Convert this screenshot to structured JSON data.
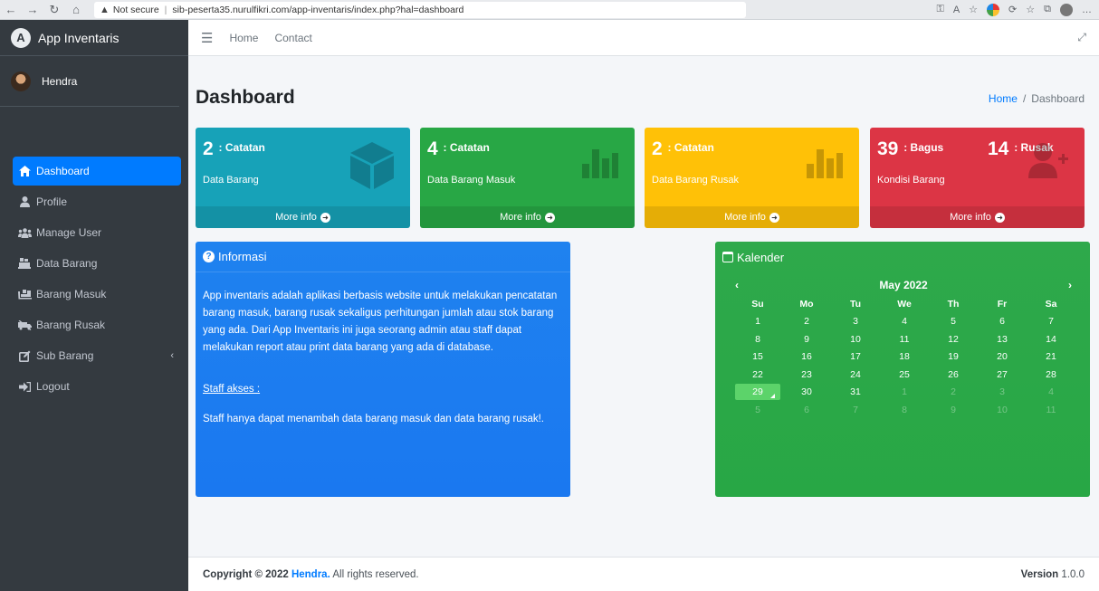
{
  "browser": {
    "security": "Not secure",
    "url": "sib-peserta35.nurulfikri.com/app-inventaris/index.php?hal=dashboard"
  },
  "sidebar": {
    "brand": "App Inventaris",
    "user": "Hendra",
    "items": [
      {
        "label": "Dashboard",
        "icon": "home-icon"
      },
      {
        "label": "Profile",
        "icon": "user-icon"
      },
      {
        "label": "Manage User",
        "icon": "users-icon"
      },
      {
        "label": "Data Barang",
        "icon": "dolly-icon"
      },
      {
        "label": "Barang Masuk",
        "icon": "truck-loading-icon"
      },
      {
        "label": "Barang Rusak",
        "icon": "truck-broken-icon"
      },
      {
        "label": "Sub Barang",
        "icon": "edit-icon"
      },
      {
        "label": "Logout",
        "icon": "sign-out-icon"
      }
    ]
  },
  "topnav": {
    "home": "Home",
    "contact": "Contact"
  },
  "page": {
    "title": "Dashboard",
    "breadcrumb_home": "Home",
    "breadcrumb_current": "Dashboard"
  },
  "boxes": {
    "b1": {
      "value": "2",
      "caption": ": Catatan",
      "label": "Data Barang",
      "more": "More info"
    },
    "b2": {
      "value": "4",
      "caption": ": Catatan",
      "label": "Data Barang Masuk",
      "more": "More info"
    },
    "b3": {
      "value": "2",
      "caption": ": Catatan",
      "label": "Data Barang Rusak",
      "more": "More info"
    },
    "b4": {
      "value": "39",
      "caption": ": Bagus",
      "value2": "14",
      "caption2": ": Rusak",
      "label": "Kondisi Barang",
      "more": "More info"
    }
  },
  "info": {
    "title": "Informasi",
    "text": "App inventaris adalah aplikasi berbasis website untuk melakukan pencatatan barang masuk, barang rusak sekaligus perhitungan jumlah atau stok barang yang ada. Dari App Inventaris ini juga seorang admin atau staff dapat melakukan report atau print data barang yang ada di database.",
    "staff_title": "Staff akses :",
    "staff_text": "Staff hanya dapat menambah data barang masuk dan data barang rusak!."
  },
  "calendar": {
    "title": "Kalender",
    "month": "May 2022",
    "prev": "‹",
    "next": "›",
    "days": [
      "Su",
      "Mo",
      "Tu",
      "We",
      "Th",
      "Fr",
      "Sa"
    ],
    "weeks": [
      [
        "1",
        "2",
        "3",
        "4",
        "5",
        "6",
        "7"
      ],
      [
        "8",
        "9",
        "10",
        "11",
        "12",
        "13",
        "14"
      ],
      [
        "15",
        "16",
        "17",
        "18",
        "19",
        "20",
        "21"
      ],
      [
        "22",
        "23",
        "24",
        "25",
        "26",
        "27",
        "28"
      ],
      [
        "29",
        "30",
        "31",
        "1",
        "2",
        "3",
        "4"
      ],
      [
        "5",
        "6",
        "7",
        "8",
        "9",
        "10",
        "11"
      ]
    ],
    "today": "29"
  },
  "footer": {
    "copyright": "Copyright © 2022 ",
    "author": "Hendra.",
    "rights": " All rights reserved.",
    "version_label": "Version",
    "version": "1.0.0"
  },
  "colors": {
    "info": "#17a2b8",
    "success": "#28a745",
    "warning": "#ffc107",
    "danger": "#dc3545",
    "primary": "#007bff"
  }
}
